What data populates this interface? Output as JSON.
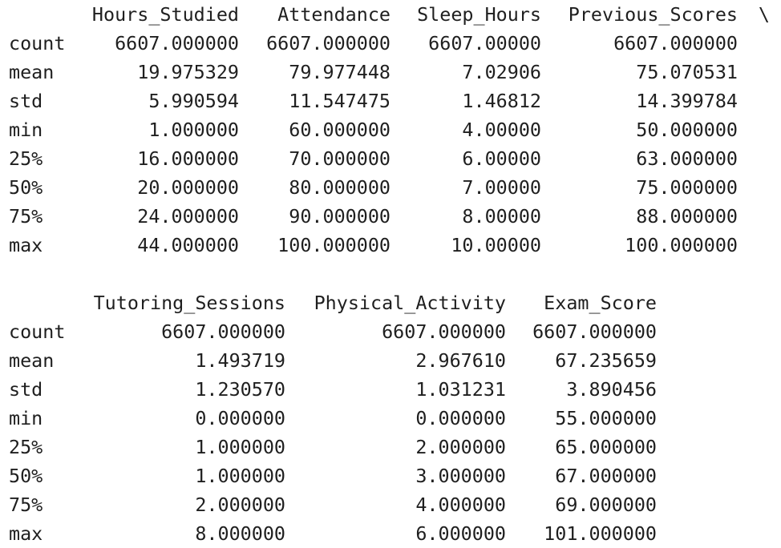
{
  "block1": {
    "columns": [
      "Hours_Studied",
      "Attendance",
      "Sleep_Hours",
      "Previous_Scores"
    ],
    "continuation": "\\",
    "rows": [
      {
        "index": "count",
        "values": [
          "6607.000000",
          "6607.000000",
          "6607.00000",
          "6607.000000"
        ]
      },
      {
        "index": "mean",
        "values": [
          "19.975329",
          "79.977448",
          "7.02906",
          "75.070531"
        ]
      },
      {
        "index": "std",
        "values": [
          "5.990594",
          "11.547475",
          "1.46812",
          "14.399784"
        ]
      },
      {
        "index": "min",
        "values": [
          "1.000000",
          "60.000000",
          "4.00000",
          "50.000000"
        ]
      },
      {
        "index": "25%",
        "values": [
          "16.000000",
          "70.000000",
          "6.00000",
          "63.000000"
        ]
      },
      {
        "index": "50%",
        "values": [
          "20.000000",
          "80.000000",
          "7.00000",
          "75.000000"
        ]
      },
      {
        "index": "75%",
        "values": [
          "24.000000",
          "90.000000",
          "8.00000",
          "88.000000"
        ]
      },
      {
        "index": "max",
        "values": [
          "44.000000",
          "100.000000",
          "10.00000",
          "100.000000"
        ]
      }
    ]
  },
  "block2": {
    "columns": [
      "Tutoring_Sessions",
      "Physical_Activity",
      "Exam_Score"
    ],
    "rows": [
      {
        "index": "count",
        "values": [
          "6607.000000",
          "6607.000000",
          "6607.000000"
        ]
      },
      {
        "index": "mean",
        "values": [
          "1.493719",
          "2.967610",
          "67.235659"
        ]
      },
      {
        "index": "std",
        "values": [
          "1.230570",
          "1.031231",
          "3.890456"
        ]
      },
      {
        "index": "min",
        "values": [
          "0.000000",
          "0.000000",
          "55.000000"
        ]
      },
      {
        "index": "25%",
        "values": [
          "1.000000",
          "2.000000",
          "65.000000"
        ]
      },
      {
        "index": "50%",
        "values": [
          "1.000000",
          "3.000000",
          "67.000000"
        ]
      },
      {
        "index": "75%",
        "values": [
          "2.000000",
          "4.000000",
          "69.000000"
        ]
      },
      {
        "index": "max",
        "values": [
          "8.000000",
          "6.000000",
          "101.000000"
        ]
      }
    ]
  }
}
